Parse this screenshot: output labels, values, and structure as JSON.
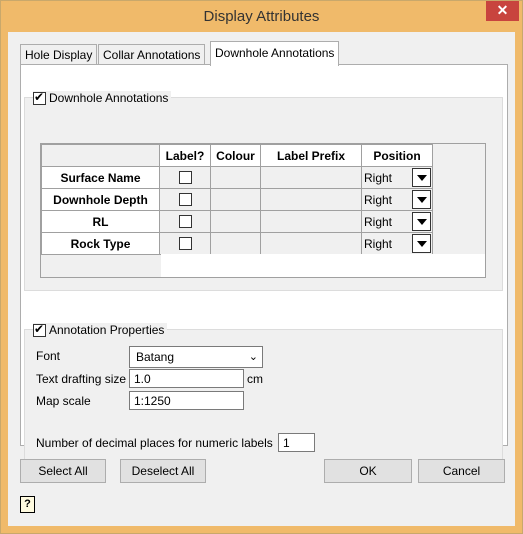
{
  "window": {
    "title": "Display Attributes",
    "close_glyph": "✕"
  },
  "tabs": [
    "Hole Display",
    "Collar Annotations",
    "Downhole Annotations"
  ],
  "downhole": {
    "checkbox_label": "Downhole Annotations",
    "columns": [
      "Label?",
      "Colour",
      "Label Prefix",
      "Position"
    ],
    "rows": [
      {
        "name": "Surface Name",
        "position": "Right"
      },
      {
        "name": "Downhole Depth",
        "position": "Right"
      },
      {
        "name": "RL",
        "position": "Right"
      },
      {
        "name": "Rock Type",
        "position": "Right"
      }
    ]
  },
  "props": {
    "checkbox_label": "Annotation Properties",
    "font_label": "Font",
    "font_value": "Batang",
    "drafting_label": "Text drafting size",
    "drafting_value": "1.0",
    "drafting_unit": "cm",
    "scale_label": "Map scale",
    "scale_value": "1:1250",
    "decimal_label": "Number of decimal places for numeric labels",
    "decimal_value": "1"
  },
  "buttons": {
    "select_all": "Select All",
    "deselect_all": "Deselect All",
    "ok": "OK",
    "cancel": "Cancel"
  },
  "help_glyph": "?"
}
